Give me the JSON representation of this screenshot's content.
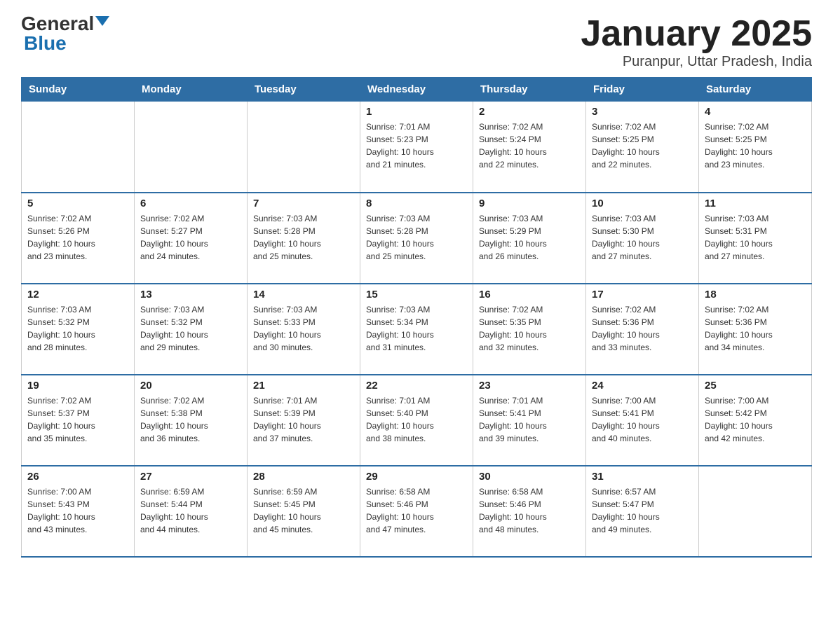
{
  "logo": {
    "text_general": "General",
    "text_blue": "Blue"
  },
  "header": {
    "month_title": "January 2025",
    "location": "Puranpur, Uttar Pradesh, India"
  },
  "days_of_week": [
    "Sunday",
    "Monday",
    "Tuesday",
    "Wednesday",
    "Thursday",
    "Friday",
    "Saturday"
  ],
  "weeks": [
    [
      {
        "day": "",
        "info": ""
      },
      {
        "day": "",
        "info": ""
      },
      {
        "day": "",
        "info": ""
      },
      {
        "day": "1",
        "info": "Sunrise: 7:01 AM\nSunset: 5:23 PM\nDaylight: 10 hours\nand 21 minutes."
      },
      {
        "day": "2",
        "info": "Sunrise: 7:02 AM\nSunset: 5:24 PM\nDaylight: 10 hours\nand 22 minutes."
      },
      {
        "day": "3",
        "info": "Sunrise: 7:02 AM\nSunset: 5:25 PM\nDaylight: 10 hours\nand 22 minutes."
      },
      {
        "day": "4",
        "info": "Sunrise: 7:02 AM\nSunset: 5:25 PM\nDaylight: 10 hours\nand 23 minutes."
      }
    ],
    [
      {
        "day": "5",
        "info": "Sunrise: 7:02 AM\nSunset: 5:26 PM\nDaylight: 10 hours\nand 23 minutes."
      },
      {
        "day": "6",
        "info": "Sunrise: 7:02 AM\nSunset: 5:27 PM\nDaylight: 10 hours\nand 24 minutes."
      },
      {
        "day": "7",
        "info": "Sunrise: 7:03 AM\nSunset: 5:28 PM\nDaylight: 10 hours\nand 25 minutes."
      },
      {
        "day": "8",
        "info": "Sunrise: 7:03 AM\nSunset: 5:28 PM\nDaylight: 10 hours\nand 25 minutes."
      },
      {
        "day": "9",
        "info": "Sunrise: 7:03 AM\nSunset: 5:29 PM\nDaylight: 10 hours\nand 26 minutes."
      },
      {
        "day": "10",
        "info": "Sunrise: 7:03 AM\nSunset: 5:30 PM\nDaylight: 10 hours\nand 27 minutes."
      },
      {
        "day": "11",
        "info": "Sunrise: 7:03 AM\nSunset: 5:31 PM\nDaylight: 10 hours\nand 27 minutes."
      }
    ],
    [
      {
        "day": "12",
        "info": "Sunrise: 7:03 AM\nSunset: 5:32 PM\nDaylight: 10 hours\nand 28 minutes."
      },
      {
        "day": "13",
        "info": "Sunrise: 7:03 AM\nSunset: 5:32 PM\nDaylight: 10 hours\nand 29 minutes."
      },
      {
        "day": "14",
        "info": "Sunrise: 7:03 AM\nSunset: 5:33 PM\nDaylight: 10 hours\nand 30 minutes."
      },
      {
        "day": "15",
        "info": "Sunrise: 7:03 AM\nSunset: 5:34 PM\nDaylight: 10 hours\nand 31 minutes."
      },
      {
        "day": "16",
        "info": "Sunrise: 7:02 AM\nSunset: 5:35 PM\nDaylight: 10 hours\nand 32 minutes."
      },
      {
        "day": "17",
        "info": "Sunrise: 7:02 AM\nSunset: 5:36 PM\nDaylight: 10 hours\nand 33 minutes."
      },
      {
        "day": "18",
        "info": "Sunrise: 7:02 AM\nSunset: 5:36 PM\nDaylight: 10 hours\nand 34 minutes."
      }
    ],
    [
      {
        "day": "19",
        "info": "Sunrise: 7:02 AM\nSunset: 5:37 PM\nDaylight: 10 hours\nand 35 minutes."
      },
      {
        "day": "20",
        "info": "Sunrise: 7:02 AM\nSunset: 5:38 PM\nDaylight: 10 hours\nand 36 minutes."
      },
      {
        "day": "21",
        "info": "Sunrise: 7:01 AM\nSunset: 5:39 PM\nDaylight: 10 hours\nand 37 minutes."
      },
      {
        "day": "22",
        "info": "Sunrise: 7:01 AM\nSunset: 5:40 PM\nDaylight: 10 hours\nand 38 minutes."
      },
      {
        "day": "23",
        "info": "Sunrise: 7:01 AM\nSunset: 5:41 PM\nDaylight: 10 hours\nand 39 minutes."
      },
      {
        "day": "24",
        "info": "Sunrise: 7:00 AM\nSunset: 5:41 PM\nDaylight: 10 hours\nand 40 minutes."
      },
      {
        "day": "25",
        "info": "Sunrise: 7:00 AM\nSunset: 5:42 PM\nDaylight: 10 hours\nand 42 minutes."
      }
    ],
    [
      {
        "day": "26",
        "info": "Sunrise: 7:00 AM\nSunset: 5:43 PM\nDaylight: 10 hours\nand 43 minutes."
      },
      {
        "day": "27",
        "info": "Sunrise: 6:59 AM\nSunset: 5:44 PM\nDaylight: 10 hours\nand 44 minutes."
      },
      {
        "day": "28",
        "info": "Sunrise: 6:59 AM\nSunset: 5:45 PM\nDaylight: 10 hours\nand 45 minutes."
      },
      {
        "day": "29",
        "info": "Sunrise: 6:58 AM\nSunset: 5:46 PM\nDaylight: 10 hours\nand 47 minutes."
      },
      {
        "day": "30",
        "info": "Sunrise: 6:58 AM\nSunset: 5:46 PM\nDaylight: 10 hours\nand 48 minutes."
      },
      {
        "day": "31",
        "info": "Sunrise: 6:57 AM\nSunset: 5:47 PM\nDaylight: 10 hours\nand 49 minutes."
      },
      {
        "day": "",
        "info": ""
      }
    ]
  ]
}
